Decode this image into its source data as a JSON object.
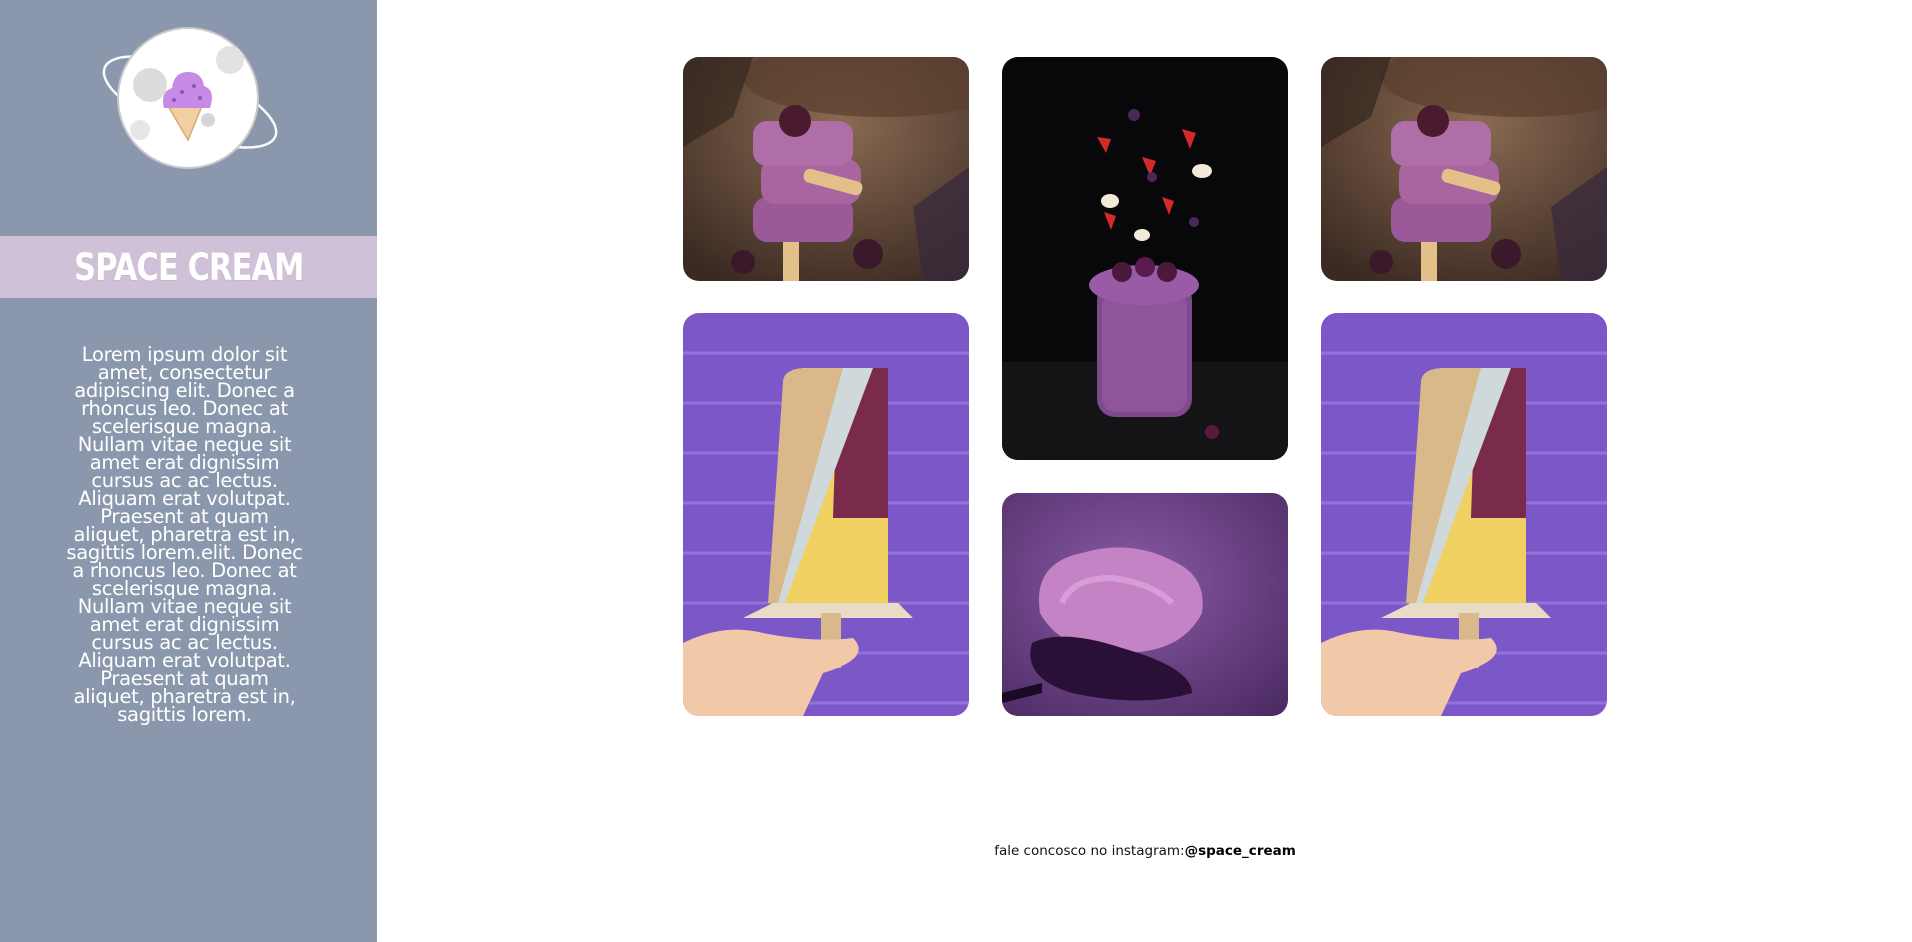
{
  "sidebar": {
    "title": "SPACE CREAM",
    "description": "Lorem ipsum dolor sit amet, consectetur adipiscing elit. Donec a rhoncus leo. Donec at scelerisque magna. Nullam vitae neque sit amet erat dignissim cursus ac ac lectus. Aliquam erat volutpat. Praesent at quam aliquet, pharetra est in, sagittis lorem.elit. Donec a rhoncus leo. Donec at scelerisque magna. Nullam vitae neque sit amet erat dignissim cursus ac ac lectus. Aliquam erat volutpat. Praesent at quam aliquet, pharetra est in, sagittis lorem."
  },
  "gallery": {
    "images": [
      {
        "subject": "stacked purple ice cream bars"
      },
      {
        "subject": "berry smoothie jar with flying fruit"
      },
      {
        "subject": "stacked purple ice cream bars"
      },
      {
        "subject": "popsicle held against purple brick wall"
      },
      {
        "subject": "scoop of purple ice cream on spoon"
      },
      {
        "subject": "popsicle held against purple brick wall"
      }
    ]
  },
  "footer": {
    "text": "fale concosco no instagram:",
    "handle": "@space_cream"
  },
  "colors": {
    "sidebar_bg": "#8b97ad",
    "title_band": "#cfc1d8",
    "accent_purple": "#7b55c9"
  }
}
